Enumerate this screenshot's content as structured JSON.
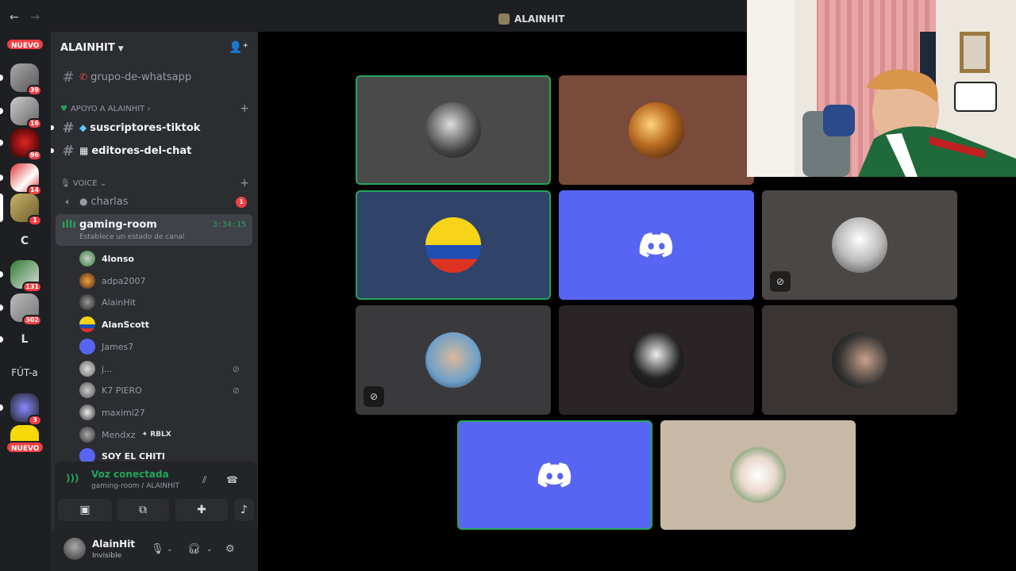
{
  "window": {
    "title": "ALAINHIT",
    "back": "←",
    "forward": "→"
  },
  "rail": {
    "nuevo_top": "NUEVO",
    "nuevo_bottom": "NUEVO",
    "servers": [
      {
        "badge": "39"
      },
      {
        "badge": "16"
      },
      {
        "badge": "96"
      },
      {
        "badge": "14"
      },
      {
        "badge": "1"
      },
      {
        "letter": "C"
      },
      {
        "badge": "131"
      },
      {
        "badge": "302"
      },
      {
        "letter": "L"
      },
      {
        "letter": "FÚT-a"
      },
      {
        "badge": "3"
      }
    ]
  },
  "sidebar": {
    "guild_name": "ALAINHIT",
    "channels_top": [
      {
        "name": "grupo-de-whatsapp"
      }
    ],
    "category_apoyo": "APOYO A ALAINHIT",
    "apoyo_channels": [
      {
        "name": "suscriptores-tiktok"
      },
      {
        "name": "editores-del-chat"
      }
    ],
    "category_voice": "VOICE",
    "voice_channels": [
      {
        "name": "charlas",
        "badge": "1"
      }
    ],
    "gaming_room": {
      "name": "gaming-room",
      "status": "Establece un estado de canal",
      "timer": "3:34:15"
    },
    "members": [
      {
        "name": "4lonso",
        "bold": true
      },
      {
        "name": "adpa2007"
      },
      {
        "name": "AlainHit"
      },
      {
        "name": "AlanScott",
        "bold": true
      },
      {
        "name": "James7"
      },
      {
        "name": "j...",
        "muted": true
      },
      {
        "name": "K7 PIERO",
        "muted": true
      },
      {
        "name": "maximi27"
      },
      {
        "name": "Mendxz",
        "tag": "RBLX"
      },
      {
        "name": "SOY EL CHITI",
        "bold": true
      }
    ]
  },
  "voice_panel": {
    "title": "Voz conectada",
    "subtitle": "gaming-room / ALAINHIT"
  },
  "user": {
    "name": "AlainHit",
    "status": "Invisible"
  },
  "colors": {
    "accent_green": "#23a55a",
    "blurple": "#5865f2",
    "danger": "#f23f43"
  }
}
